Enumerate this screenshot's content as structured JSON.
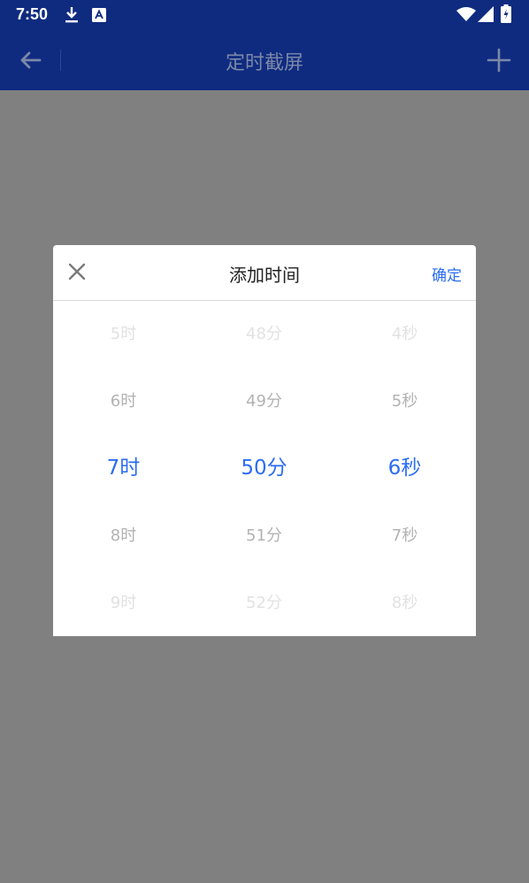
{
  "status_bar": {
    "time": "7:50"
  },
  "app_bar": {
    "title": "定时截屏"
  },
  "dialog": {
    "title": "添加时间",
    "confirm_label": "确定",
    "hours": [
      "5时",
      "6时",
      "7时",
      "8时",
      "9时"
    ],
    "minutes": [
      "48分",
      "49分",
      "50分",
      "51分",
      "52分"
    ],
    "seconds": [
      "4秒",
      "5秒",
      "6秒",
      "7秒",
      "8秒"
    ],
    "selected": {
      "hour": "7时",
      "minute": "50分",
      "second": "6秒"
    }
  },
  "colors": {
    "header_bg": "#0f2b80",
    "overlay": "#808080",
    "accent": "#2a6df2"
  },
  "icons": {
    "download": "download-icon",
    "notification_a": "a-box-icon",
    "wifi": "wifi-icon",
    "signal": "signal-icon",
    "battery": "battery-icon",
    "back": "arrow-left-icon",
    "add": "plus-icon",
    "close": "close-icon"
  }
}
